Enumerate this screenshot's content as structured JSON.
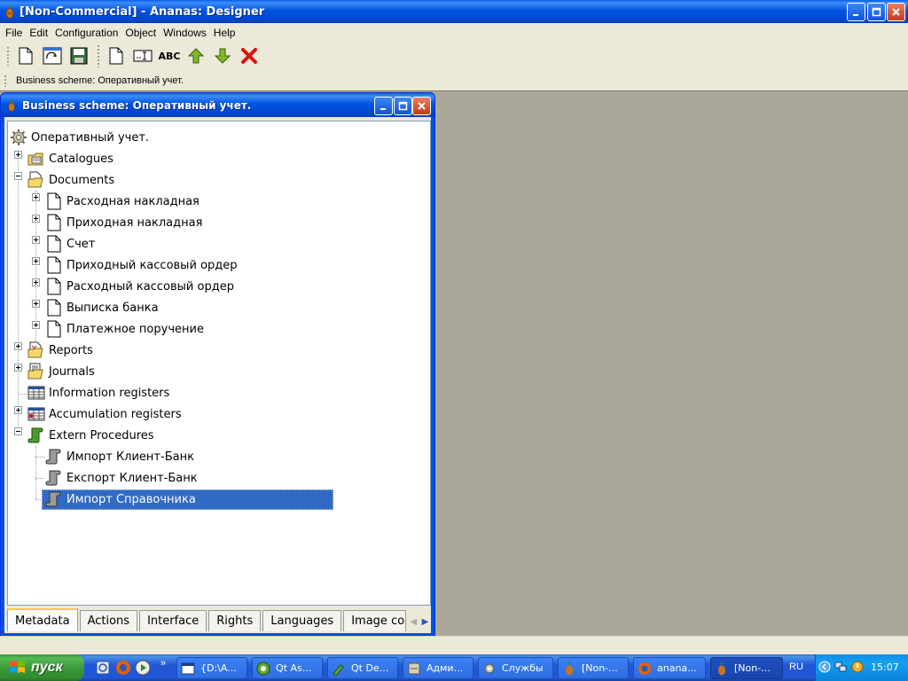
{
  "window": {
    "title": "[Non-Commercial] - Ananas: Designer"
  },
  "menu": {
    "items": [
      "File",
      "Edit",
      "Configuration",
      "Object",
      "Windows",
      "Help"
    ]
  },
  "toolbar": {
    "icons": [
      "new-file-icon",
      "open-icon",
      "save-icon",
      "new-object-icon",
      "edit-field-icon",
      "spell-check-icon",
      "move-up-icon",
      "move-down-icon",
      "delete-icon"
    ],
    "abc_label": "ABC"
  },
  "context": {
    "text": "Business scheme: Оперативный учет."
  },
  "child": {
    "title": "Business scheme: Оперативный учет.",
    "tree": {
      "root": "Оперативный учет.",
      "catalogues": "Catalogues",
      "documents": "Documents",
      "doc_items": [
        "Расходная накладная",
        "Приходная накладная",
        "Счет",
        "Приходный кассовый ордер",
        "Расходный кассовый ордер",
        "Выписка банка",
        "Платежное поручение"
      ],
      "reports": "Reports",
      "journals": "Journals",
      "info_registers": "Information registers",
      "accum_registers": "Accumulation registers",
      "extern": "Extern Procedures",
      "extern_items": [
        "Импорт  Клиент-Банк",
        "Експорт Клиент-Банк",
        "Импорт Справочника"
      ],
      "selected": "Импорт Справочника"
    },
    "tabs": [
      "Metadata",
      "Actions",
      "Interface",
      "Rights",
      "Languages",
      "Image colle"
    ],
    "active_tab": "Metadata"
  },
  "taskbar": {
    "start_label": "пуск",
    "tasks": [
      "{D:\\A...",
      "Qt As...",
      "Qt De...",
      "Адми...",
      "Службы",
      "[Non-...",
      "anana...",
      "[Non-..."
    ],
    "active_task_index": 7,
    "language": "RU",
    "clock": "15:07"
  },
  "colors": {
    "title_blue": "#0054e3",
    "selection": "#316ac5",
    "mdi_background": "#aca899",
    "start_green": "#3a9b3a"
  }
}
